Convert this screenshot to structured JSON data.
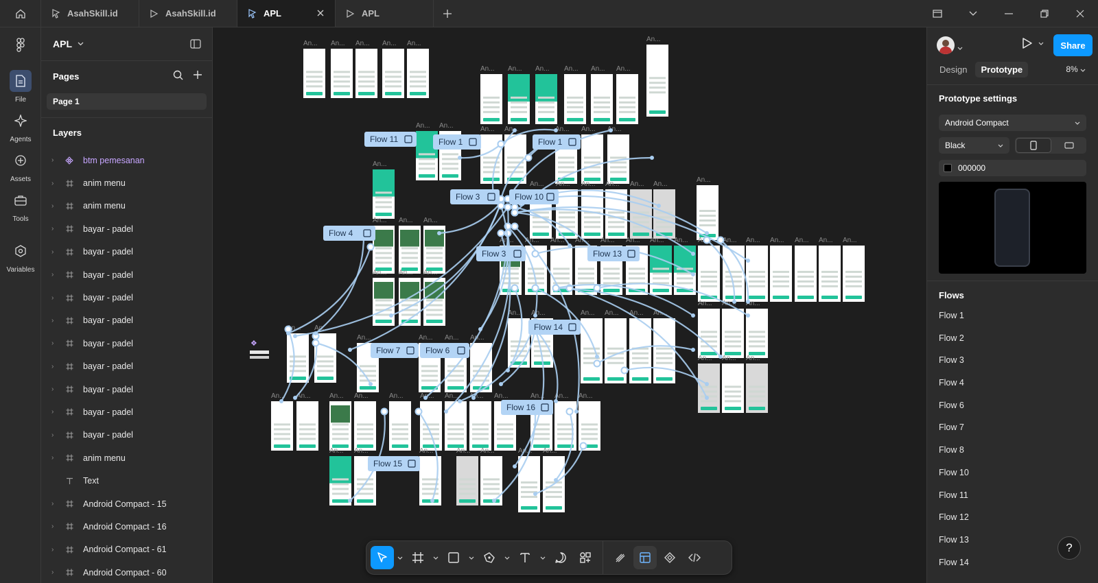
{
  "titlebar": {
    "tabs": [
      {
        "label": "AsahSkill.id",
        "icon": "figma-file-icon",
        "active": false
      },
      {
        "label": "AsahSkill.id",
        "icon": "play-icon",
        "active": false
      },
      {
        "label": "APL",
        "icon": "figma-file-icon",
        "active": true
      },
      {
        "label": "APL",
        "icon": "play-icon",
        "active": false
      }
    ]
  },
  "rail": {
    "items": [
      {
        "label": "File",
        "icon": "file-icon",
        "active": true
      },
      {
        "label": "Agents",
        "icon": "sparkle-icon",
        "active": false
      },
      {
        "label": "Assets",
        "icon": "assets-icon",
        "active": false
      },
      {
        "label": "Tools",
        "icon": "toolbox-icon",
        "active": false
      },
      {
        "label": "Variables",
        "icon": "variables-icon",
        "active": false
      }
    ]
  },
  "left_panel": {
    "file_name": "APL",
    "pages_title": "Pages",
    "current_page": "Page 1",
    "layers_title": "Layers",
    "layers": [
      {
        "label": "btm pemesanan",
        "type": "component"
      },
      {
        "label": "anim menu",
        "type": "frame"
      },
      {
        "label": "anim menu",
        "type": "frame"
      },
      {
        "label": "bayar - padel",
        "type": "frame"
      },
      {
        "label": "bayar - padel",
        "type": "frame"
      },
      {
        "label": "bayar - padel",
        "type": "frame"
      },
      {
        "label": "bayar - padel",
        "type": "frame"
      },
      {
        "label": "bayar - padel",
        "type": "frame"
      },
      {
        "label": "bayar - padel",
        "type": "frame"
      },
      {
        "label": "bayar - padel",
        "type": "frame"
      },
      {
        "label": "bayar - padel",
        "type": "frame"
      },
      {
        "label": "bayar - padel",
        "type": "frame"
      },
      {
        "label": "bayar - padel",
        "type": "frame"
      },
      {
        "label": "anim menu",
        "type": "frame"
      },
      {
        "label": "Text",
        "type": "text"
      },
      {
        "label": "Android Compact - 15",
        "type": "frame"
      },
      {
        "label": "Android Compact - 16",
        "type": "frame"
      },
      {
        "label": "Android Compact - 61",
        "type": "frame"
      },
      {
        "label": "Android Compact - 60",
        "type": "frame"
      }
    ]
  },
  "canvas": {
    "flow_badges": [
      "Flow 11",
      "Flow 1",
      "Flow 1",
      "Flow 3",
      "Flow 10",
      "Flow 4",
      "Flow 3",
      "Flow 13",
      "Flow 14",
      "Flow 7",
      "Flow 6",
      "Flow 16",
      "Flow 15"
    ],
    "frame_label": "An..."
  },
  "toolbar": {
    "tools": [
      "move-tool",
      "frame-tool",
      "rectangle-tool",
      "pen-tool",
      "text-tool",
      "comment-tool",
      "actions-tool"
    ],
    "modes": [
      "draw-mode",
      "design-mode",
      "dev-component-mode",
      "dev-mode"
    ]
  },
  "right_panel": {
    "share_label": "Share",
    "tabs": [
      "Design",
      "Prototype"
    ],
    "active_tab": "Prototype",
    "zoom": "8%",
    "settings_title": "Prototype settings",
    "device": "Android Compact",
    "device_color": "Black",
    "background_hex": "000000",
    "flows_title": "Flows",
    "flows": [
      "Flow 1",
      "Flow 2",
      "Flow 3",
      "Flow 4",
      "Flow 6",
      "Flow 7",
      "Flow 8",
      "Flow 10",
      "Flow 11",
      "Flow 12",
      "Flow 13",
      "Flow 14"
    ],
    "help": "?"
  },
  "colors": {
    "accent": "#0d99ff",
    "flow_line": "#a9cdf0",
    "flow_badge": "#b3d4f5",
    "frame_teal": "#22c39a",
    "component_purple": "#c7a6ff",
    "background": "#1e1e1e",
    "panel": "#2c2c2c"
  }
}
